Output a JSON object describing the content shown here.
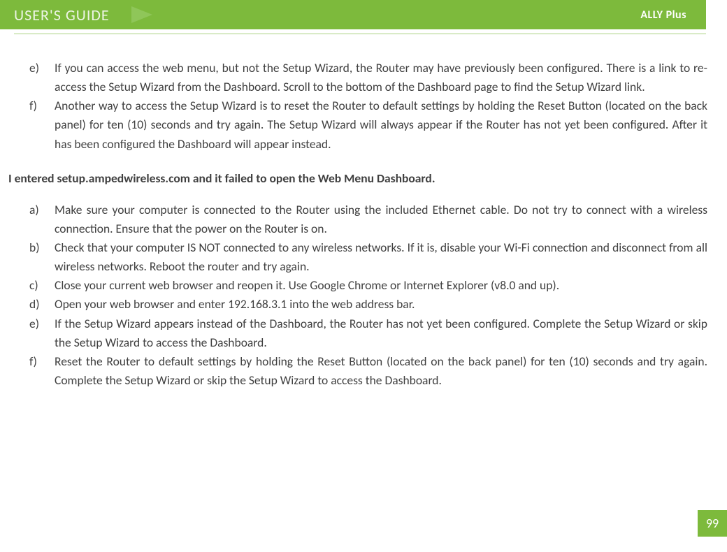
{
  "header": {
    "title": "USER'S GUIDE",
    "product": "ALLY Plus"
  },
  "list1": [
    {
      "marker": "e)",
      "text": "If you can access the web menu, but not the Setup Wizard, the Router may have previously been configured.  There is a link to re-access the Setup Wizard from the Dashboard.  Scroll to the bottom of the Dashboard page to find the Setup Wizard link."
    },
    {
      "marker": "f)",
      "text": "Another way to access the Setup Wizard is to reset the Router to default settings by holding the Reset Button (located on the back panel) for ten (10) seconds and try again.  The Setup Wizard will always appear if the Router has not yet been configured.  After it has been configured the Dashboard will appear instead."
    }
  ],
  "heading2": "I entered setup.ampedwireless.com and it failed to open the Web Menu Dashboard.",
  "list2": [
    {
      "marker": "a)",
      "text": "Make sure your computer is connected to the Router using the included Ethernet cable. Do not try to connect with a wireless connection. Ensure that the power on the Router is on."
    },
    {
      "marker": "b)",
      "text": "Check that your computer IS NOT connected to any wireless networks. If it is, disable your Wi-Fi connection and disconnect from all wireless networks. Reboot the router and try again."
    },
    {
      "marker": "c)",
      "text": "Close your current web browser and reopen it.  Use Google Chrome or Internet Explorer (v8.0 and up)."
    },
    {
      "marker": "d)",
      "text": "Open your web browser and enter 192.168.3.1 into the web address bar."
    },
    {
      "marker": "e)",
      "text": "If the Setup Wizard appears instead of the Dashboard, the Router has not yet been configured. Complete the Setup Wizard or skip the Setup Wizard to access the Dashboard."
    },
    {
      "marker": "f)",
      "text": "Reset the Router to default settings by holding the Reset Button (located on the back panel) for ten (10) seconds and try again.  Complete the Setup Wizard or skip the Setup Wizard to access the Dashboard."
    }
  ],
  "page_number": "99"
}
